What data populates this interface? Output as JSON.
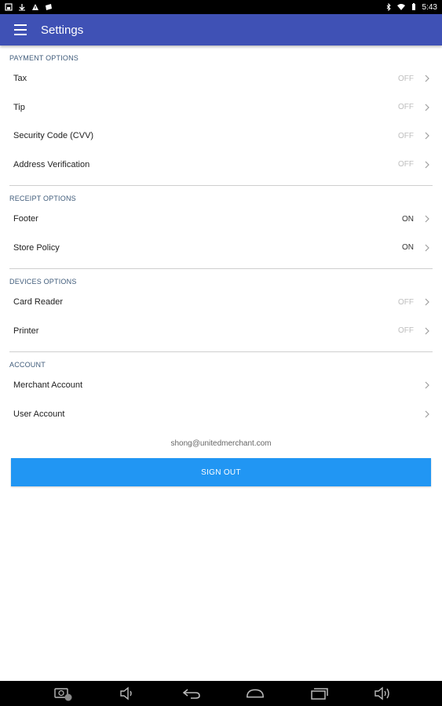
{
  "status_bar": {
    "time": "5:43",
    "left_icons": [
      "screenshot-icon",
      "download-icon",
      "alert-icon",
      "photo-icon"
    ],
    "right_icons": [
      "bluetooth-icon",
      "wifi-icon",
      "battery-icon"
    ]
  },
  "app_bar": {
    "title": "Settings",
    "menu_icon": "hamburger-menu-icon",
    "color": "#3f51b5"
  },
  "sections": {
    "payment": {
      "header": "PAYMENT OPTIONS",
      "items": [
        {
          "label": "Tax",
          "value": "OFF"
        },
        {
          "label": "Tip",
          "value": "OFF"
        },
        {
          "label": "Security Code (CVV)",
          "value": "OFF"
        },
        {
          "label": "Address Verification",
          "value": "OFF"
        }
      ]
    },
    "receipt": {
      "header": "RECEIPT OPTIONS",
      "items": [
        {
          "label": "Footer",
          "value": "ON"
        },
        {
          "label": "Store Policy",
          "value": "ON"
        }
      ]
    },
    "devices": {
      "header": "DEVICES OPTIONS",
      "items": [
        {
          "label": "Card Reader",
          "value": "OFF"
        },
        {
          "label": "Printer",
          "value": "OFF"
        }
      ]
    },
    "account": {
      "header": "ACCOUNT",
      "items": [
        {
          "label": "Merchant Account"
        },
        {
          "label": "User Account"
        }
      ]
    }
  },
  "account_email": "shong@unitedmerchant.com",
  "sign_out_label": "SIGN OUT",
  "sign_out_color": "#2196f3",
  "nav_bar": {
    "icons": [
      "screenshot-icon",
      "volume-down-icon",
      "back-icon",
      "home-icon",
      "recents-icon",
      "volume-up-icon"
    ]
  }
}
